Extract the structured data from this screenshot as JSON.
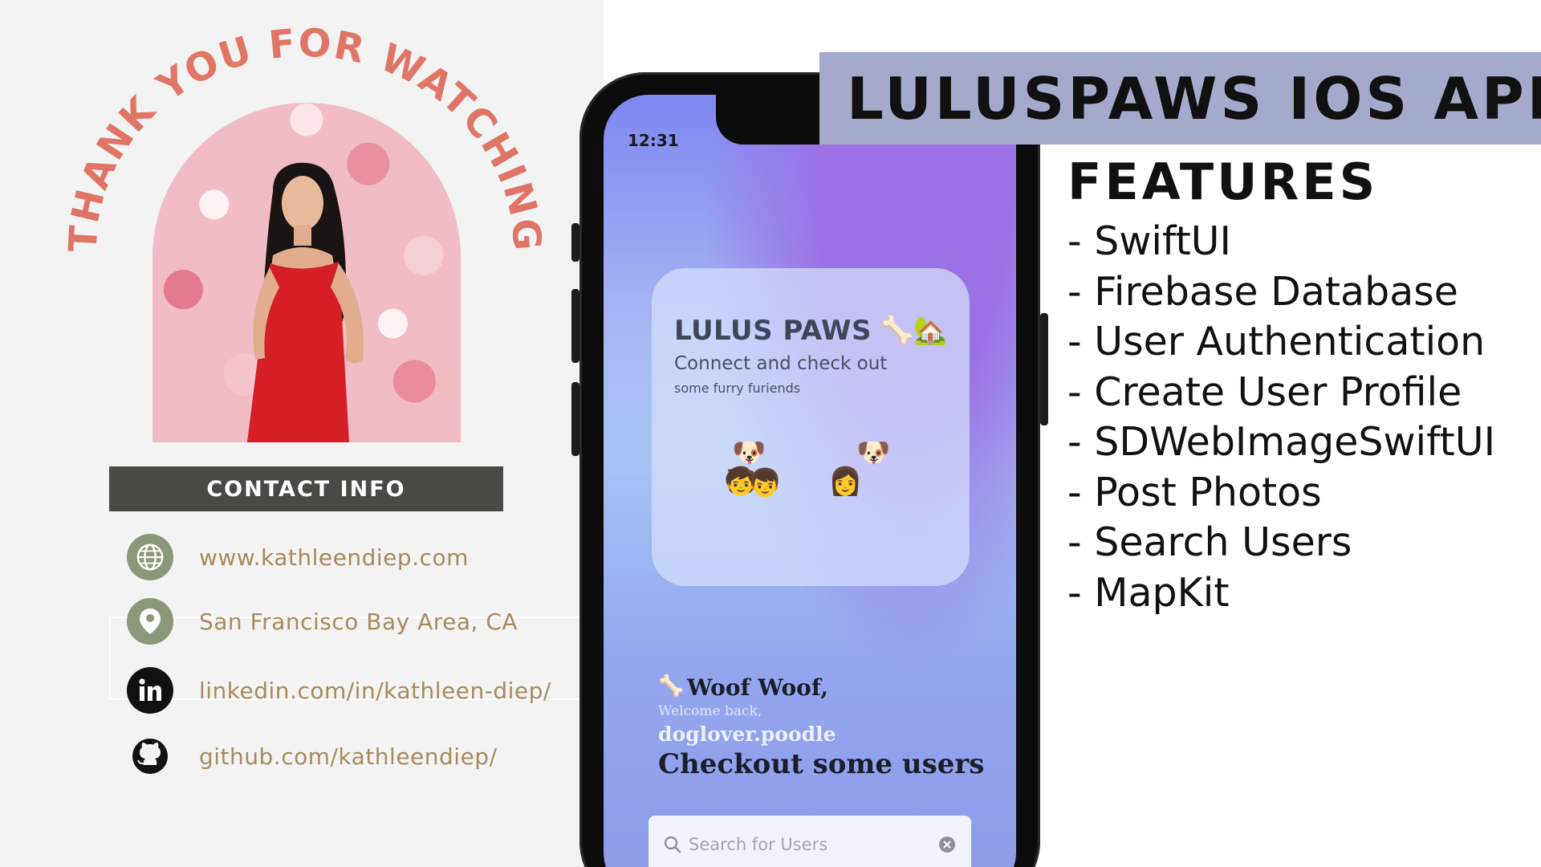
{
  "banner": {
    "title": "LULUSPAWS IOS APP"
  },
  "features": {
    "heading": "FEATURES",
    "items": [
      "- SwiftUI",
      "- Firebase Database",
      "- User Authentication",
      "- Create User Profile",
      "- SDWebImageSwiftUI",
      "- Post Photos",
      "- Search Users",
      "- MapKit"
    ]
  },
  "left": {
    "arc_text": "THANK YOU FOR WATCHING",
    "contact_header": "CONTACT INFO",
    "contacts": [
      {
        "icon": "globe-icon",
        "text": "www.kathleendiep.com"
      },
      {
        "icon": "location-pin-icon",
        "text": "San Francisco Bay Area, CA"
      },
      {
        "icon": "linkedin-icon",
        "text": "linkedin.com/in/kathleen-diep/"
      },
      {
        "icon": "github-icon",
        "text": "github.com/kathleendiep/"
      }
    ]
  },
  "phone": {
    "status_time": "12:31",
    "widget": {
      "title": "LULUS PAWS",
      "title_emoji": "🦴🏡",
      "subtitle": "Connect and check out",
      "subtitle2": "some furry furiends"
    },
    "app": {
      "greeting": "Woof Woof,",
      "welcome": "Welcome back,",
      "username": "doglover.poodle",
      "heading": "Checkout some users"
    },
    "search": {
      "placeholder": "Search for Users"
    }
  },
  "colors": {
    "accent_coral": "#e07565",
    "banner_lavender": "#a3aacb",
    "contact_gold": "#a88a5c",
    "icon_sage": "#8a9778"
  }
}
